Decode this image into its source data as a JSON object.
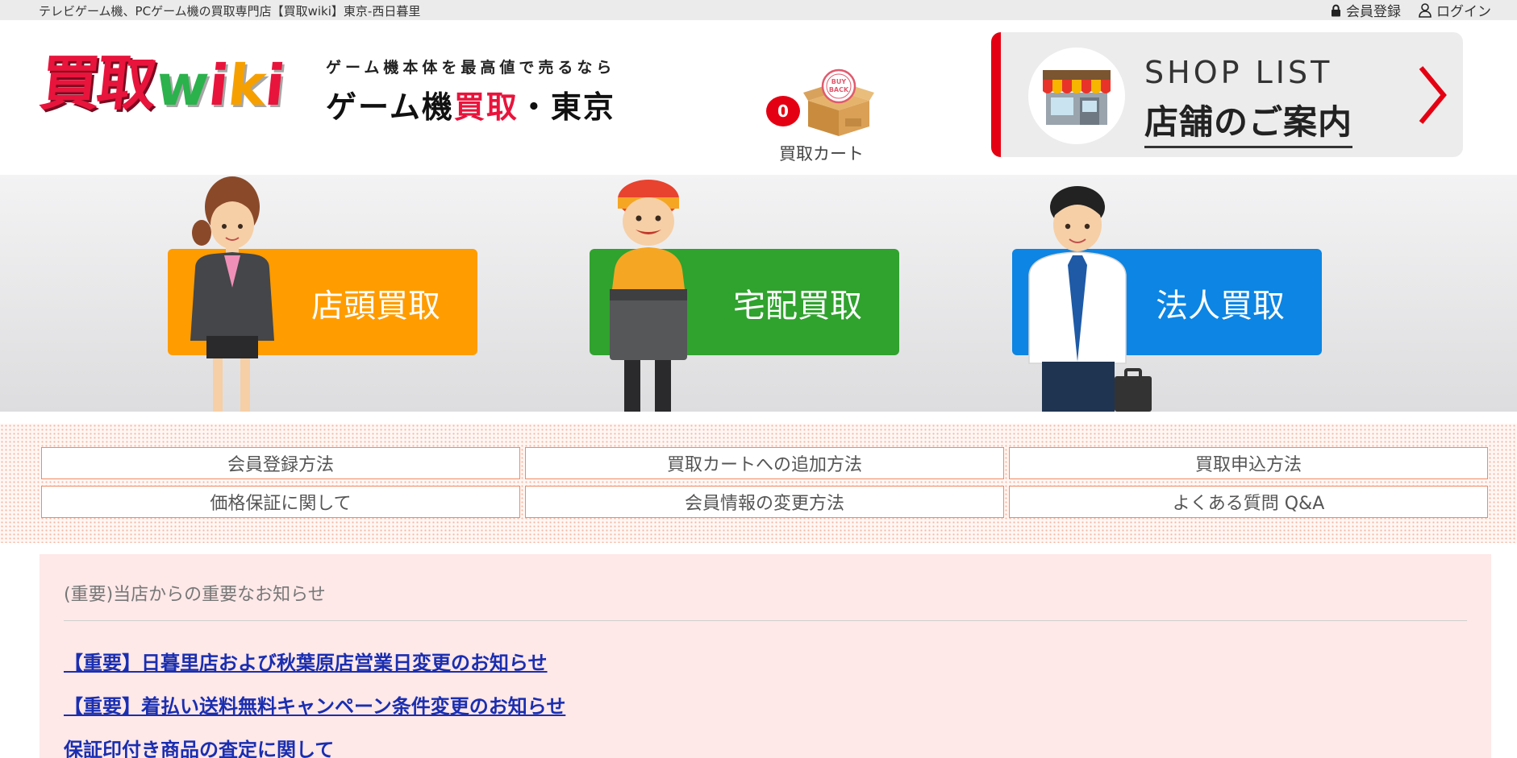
{
  "topbar": {
    "tagline": "テレビゲーム機、PCゲーム機の買取専門店【買取wiki】東京-西日暮里",
    "register_label": "会員登録",
    "login_label": "ログイン"
  },
  "logo": {
    "main": "買取",
    "wiki_letters": [
      "w",
      "i",
      "k",
      "i"
    ]
  },
  "catch": {
    "sub": "ゲーム機本体を最高値で売るなら",
    "main_prefix": "ゲーム機",
    "main_red": "買取",
    "main_suffix": "・東京"
  },
  "cart": {
    "count": "0",
    "label": "買取カート",
    "stamp_text_1": "BUY",
    "stamp_text_2": "BACK"
  },
  "shoplist": {
    "en": "SHOP LIST",
    "jp": "店舗のご案内"
  },
  "hero": {
    "store_label": "店頭買取",
    "delivery_label": "宅配買取",
    "corporate_label": "法人買取"
  },
  "guide": {
    "items": [
      "会員登録方法",
      "買取カートへの追加方法",
      "買取申込方法",
      "価格保証に関して",
      "会員情報の変更方法",
      "よくある質問 Q&A"
    ]
  },
  "notice": {
    "heading": "(重要)当店からの重要なお知らせ",
    "links": [
      "【重要】日暮里店および秋葉原店営業日変更のお知らせ",
      "【重要】着払い送料無料キャンペーン条件変更のお知らせ",
      "保証印付き商品の査定に関して"
    ]
  },
  "colors": {
    "brand_red": "#e40012",
    "store_orange": "#ff9c00",
    "delivery_green": "#30a22e",
    "corporate_blue": "#0c85e4",
    "link_blue": "#1a2eb0",
    "notice_bg": "#fee8e8"
  }
}
